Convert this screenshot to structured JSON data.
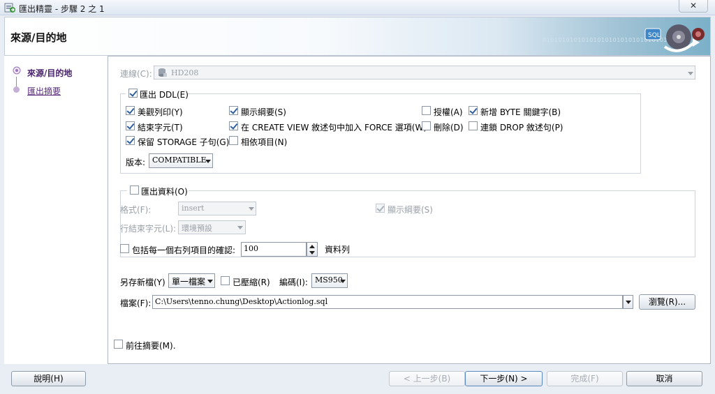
{
  "window": {
    "title": "匯出精靈 - 步驟 2 之 1",
    "close_label": "✕"
  },
  "banner": {
    "title": "來源/目的地",
    "binary_text": "010101010101010101010101010101010"
  },
  "sidebar": {
    "steps": [
      {
        "label": "來源/目的地",
        "active": true
      },
      {
        "label": "匯出摘要",
        "active": false
      }
    ]
  },
  "connection": {
    "label": "連線(C):",
    "value": "HD208"
  },
  "export_ddl": {
    "label": "匯出 DDL(E)",
    "checked": true,
    "options": {
      "pretty_print": {
        "label": "美觀列印(Y)",
        "checked": true
      },
      "show_schema": {
        "label": "顯示綱要(S)",
        "checked": true
      },
      "grants": {
        "label": "授權(A)",
        "checked": false
      },
      "byte_keyword": {
        "label": "新增 BYTE 關鍵字(B)",
        "checked": true
      },
      "terminator": {
        "label": "結束字元(T)",
        "checked": true
      },
      "force_view": {
        "label": "在 CREATE VIEW 敘述句中加入 FORCE 選項(W)",
        "checked": true
      },
      "drop": {
        "label": "刪除(D)",
        "checked": false
      },
      "cascade_drop": {
        "label": "連鎖 DROP 敘述句(P)",
        "checked": false
      },
      "storage": {
        "label": "保留 STORAGE 子句(G)",
        "checked": true
      },
      "dependents": {
        "label": "相依項目(N)",
        "checked": false
      }
    },
    "version_label": "版本:",
    "version_value": "COMPATIBLE"
  },
  "export_data": {
    "label": "匯出資料(O)",
    "checked": false,
    "format_label": "格式(F):",
    "format_value": "insert",
    "line_term_label": "行結束字元(L):",
    "line_term_value": "環境預設",
    "show_schema_label": "顯示綱要(S)",
    "show_schema_checked": true,
    "commit_label": "包括每一個右列項目的確認:",
    "commit_value": "100",
    "commit_unit": "資料列"
  },
  "save_as": {
    "label": "另存新檔(Y)",
    "value": "單一檔案",
    "compressed_label": "已壓縮(R)",
    "encoding_label": "編碼(I):",
    "encoding_value": "MS950"
  },
  "file": {
    "label": "檔案(F):",
    "value": "C:\\Users\\tenno.chung\\Desktop\\Actionlog.sql",
    "browse_label": "瀏覽(R)..."
  },
  "goto_summary": {
    "label": "前往摘要(M).",
    "checked": false
  },
  "footer": {
    "help": "說明(H)",
    "back": "< 上一步(B)",
    "next": "下一步(N) >",
    "finish": "完成(F)",
    "cancel": "取消"
  }
}
